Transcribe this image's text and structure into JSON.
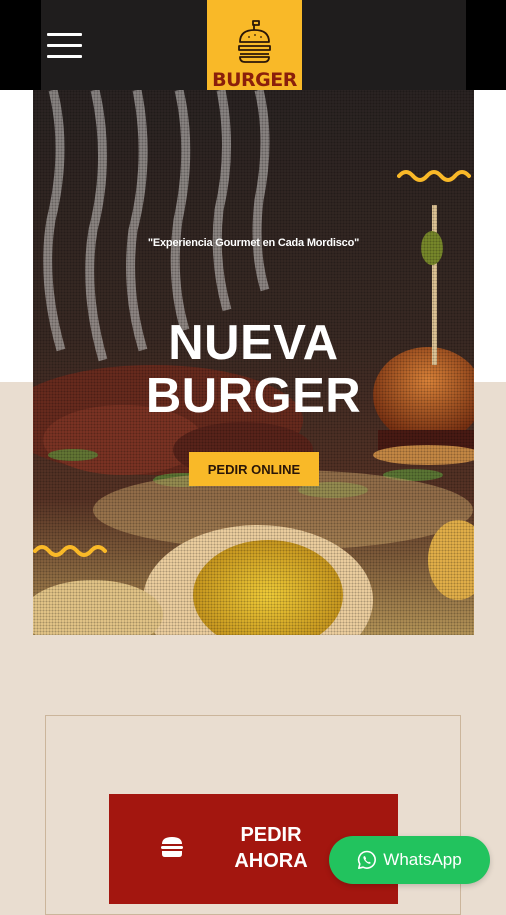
{
  "header": {
    "menu_icon": "hamburger-menu-icon",
    "logo_text": "BURGER",
    "logo_icon": "burger-icon",
    "colors": {
      "bar": "#1f1d1d",
      "logo_bg": "#f9b928",
      "logo_text": "#8a1f0b"
    }
  },
  "hero": {
    "tagline": "\"Experiencia Gourmet en Cada Mordisco\"",
    "title_line1": "NUEVA",
    "title_line2": "BURGER",
    "cta_label": "PEDIR ONLINE",
    "colors": {
      "cta_bg": "#f9b928",
      "squiggle": "#f9b928"
    }
  },
  "order": {
    "label": "PEDIR AHORA",
    "icon": "burger-icon",
    "colors": {
      "bg": "#a3160f"
    }
  },
  "whatsapp": {
    "label": "WhatsApp",
    "icon": "whatsapp-icon",
    "colors": {
      "bg": "#22c35e"
    }
  }
}
